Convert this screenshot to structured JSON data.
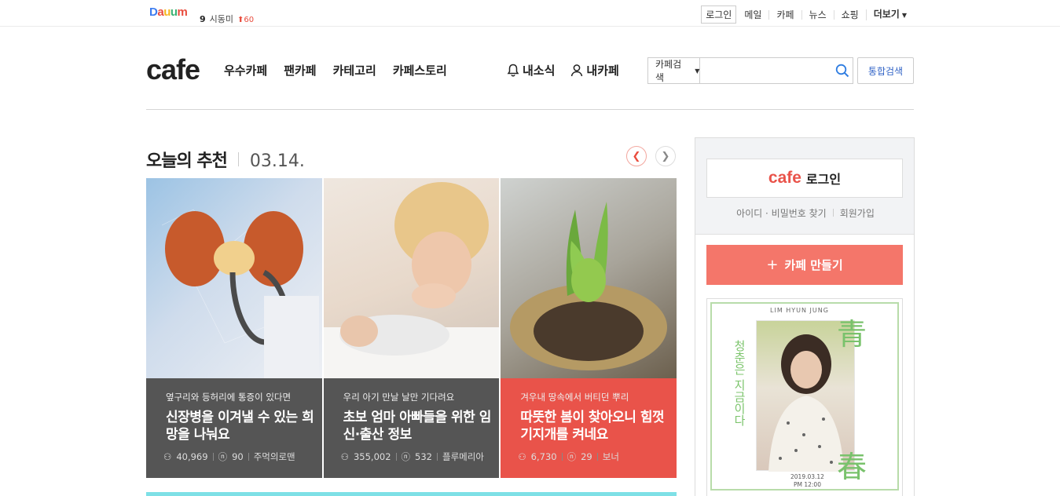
{
  "topbar": {
    "logo": [
      "D",
      "a",
      "u",
      "u",
      "m"
    ],
    "trend_rank": "9",
    "trend_keyword": "시동미",
    "trend_change": "60",
    "login": "로그인",
    "links": [
      "메일",
      "카페",
      "뉴스",
      "쇼핑"
    ],
    "more": "더보기"
  },
  "header": {
    "logo": "cafe",
    "gnb": [
      "우수카페",
      "팬카페",
      "카테고리",
      "카페스토리"
    ],
    "news": "내소식",
    "mycafe": "내카페",
    "search_select": "카페검색",
    "search_placeholder": "",
    "total_search": "통합검색"
  },
  "today": {
    "title": "오늘의 추천",
    "date": "03.14.",
    "cards": [
      {
        "sub": "옆구리와 등허리에 통증이 있다면",
        "title": "신장병을 이겨낼 수 있는 희망을 나눠요",
        "members": "40,969",
        "posts": "90",
        "cafe": "주먹의로맨"
      },
      {
        "sub": "우리 아기 만날 날만 기다려요",
        "title": "초보 엄마 아빠들을 위한 임신·출산 정보",
        "members": "355,002",
        "posts": "532",
        "cafe": "플루메리아"
      },
      {
        "sub": "겨우내 땅속에서 버티던 뿌리",
        "title": "따뜻한 봄이 찾아오니 힘껏 기지개를 켜네요",
        "members": "6,730",
        "posts": "29",
        "cafe": "보너"
      }
    ]
  },
  "side": {
    "login_logo": "cafe",
    "login_label": "로그인",
    "find_id": "아이디 · 비밀번호 찾기",
    "join": "회원가입",
    "make_cafe": "카페 만들기",
    "ad": {
      "artist": "LIM HYUN JUNG",
      "vertical_text": "청춘은 지금이다",
      "char_top": "青",
      "char_bottom": "春",
      "release_date": "2019.03.12",
      "release_time": "PM 12:00"
    }
  },
  "colors": {
    "accent_red": "#e9534a",
    "button_coral": "#f4766a",
    "link_blue": "#3163c6",
    "dark_card": "#555555"
  }
}
